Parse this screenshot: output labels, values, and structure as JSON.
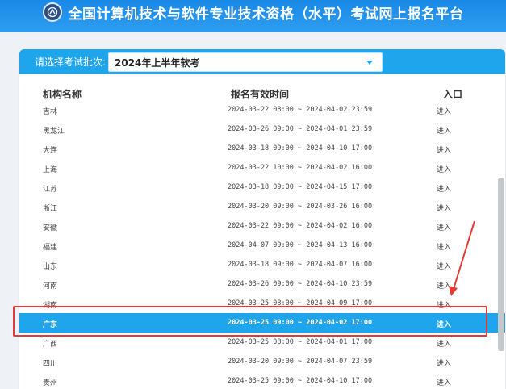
{
  "header": {
    "title": "全国计算机技术与软件专业技术资格（水平）考试网上报名平台"
  },
  "batch": {
    "label": "请选择考试批次:",
    "selected": "2024年上半年软考"
  },
  "table": {
    "columns": [
      "机构名称",
      "报名有效时间",
      "入口"
    ],
    "rows": [
      {
        "name": "吉林",
        "time": "2024-03-22 08:00 ~ 2024-04-02 23:59",
        "entry": "进入"
      },
      {
        "name": "黑龙江",
        "time": "2024-03-26 09:00 ~ 2024-04-01 23:59",
        "entry": "进入"
      },
      {
        "name": "大连",
        "time": "2024-03-18 09:00 ~ 2024-04-10 17:00",
        "entry": "进入"
      },
      {
        "name": "上海",
        "time": "2024-03-22 10:00 ~ 2024-04-02 16:00",
        "entry": "进入"
      },
      {
        "name": "江苏",
        "time": "2024-03-18 09:00 ~ 2024-04-15 17:00",
        "entry": "进入"
      },
      {
        "name": "浙江",
        "time": "2024-03-20 09:00 ~ 2024-03-26 16:00",
        "entry": "进入"
      },
      {
        "name": "安徽",
        "time": "2024-03-22 09:00 ~ 2024-04-02 16:00",
        "entry": "进入"
      },
      {
        "name": "福建",
        "time": "2024-04-07 09:00 ~ 2024-04-13 16:00",
        "entry": "进入"
      },
      {
        "name": "山东",
        "time": "2024-03-18 09:00 ~ 2024-04-07 16:00",
        "entry": "进入"
      },
      {
        "name": "河南",
        "time": "2024-03-26 09:00 ~ 2024-04-10 23:59",
        "entry": "进入"
      },
      {
        "name": "湖南",
        "time": "2024-03-25 08:00 ~ 2024-04-09 17:00",
        "entry": "进入"
      },
      {
        "name": "广东",
        "time": "2024-03-25 09:00 ~ 2024-04-02 17:00",
        "entry": "进入",
        "selected": true
      },
      {
        "name": "广西",
        "time": "2024-03-25 08:00 ~ 2024-04-01 17:00",
        "entry": "进入"
      },
      {
        "name": "四川",
        "time": "2024-03-20 09:00 ~ 2024-04-07 23:59",
        "entry": "进入"
      },
      {
        "name": "贵州",
        "time": "2024-03-25 09:00 ~ 2024-04-10 17:00",
        "entry": "进入"
      }
    ]
  },
  "colors": {
    "banner": "#1a88e6",
    "accent": "#1ea5ec",
    "selected_row": "#1ea5ec",
    "annotation": "#e53935"
  }
}
